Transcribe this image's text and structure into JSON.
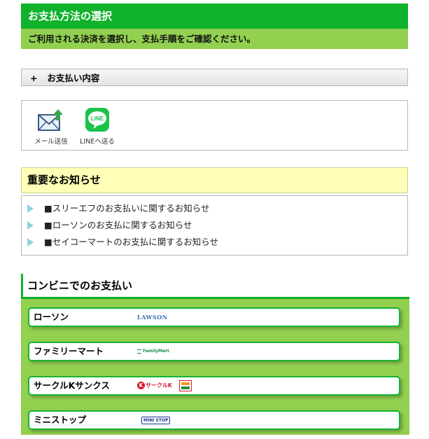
{
  "header": {
    "title": "お支払方法の選択",
    "subtitle": "ご利用される決済を選択し、支払手順をご確認ください。"
  },
  "accordion": {
    "plus": "+",
    "label": "お支払い内容"
  },
  "share": {
    "mail_label": "メール送信",
    "line_label": "LINEへ送る",
    "line_icon_text": "LINE"
  },
  "notice": {
    "title": "重要なお知らせ",
    "items": [
      "■スリーエフのお支払いに関するお知らせ",
      "■ローソンのお支払に関するお知らせ",
      "■セイコーマートのお支払に関するお知らせ"
    ]
  },
  "convenience": {
    "title": "コンビニでのお支払い",
    "stores": [
      {
        "name": "ローソン",
        "logo_text": "LAWSON"
      },
      {
        "name": "ファミリーマート",
        "logo_text": "FamilyMart"
      },
      {
        "name": "サークルKサンクス",
        "logo_text": "サークルK"
      },
      {
        "name": "ミニストップ",
        "logo_text": "MINI STOP"
      }
    ]
  },
  "colors": {
    "header_green": "#0fb22a",
    "sub_green": "#92d050",
    "notice_yellow": "#ffffb8",
    "triangle": "#8fd3dd"
  }
}
